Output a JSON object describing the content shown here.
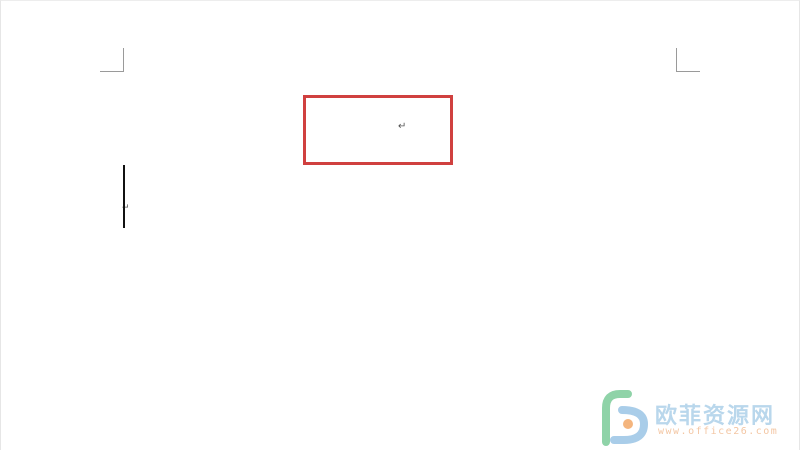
{
  "document": {
    "paragraph_mark": "↵",
    "paragraph_mark_small": "↵"
  },
  "watermark": {
    "title": "欧菲资源网",
    "url": "www.office26.com",
    "colors": {
      "title": "#b9d7ec",
      "url": "#f3c6a3",
      "logo_green": "#8fd3a8",
      "logo_blue": "#a9cde9",
      "logo_orange": "#f4b57e"
    }
  },
  "highlight": {
    "color": "#d0403f"
  }
}
